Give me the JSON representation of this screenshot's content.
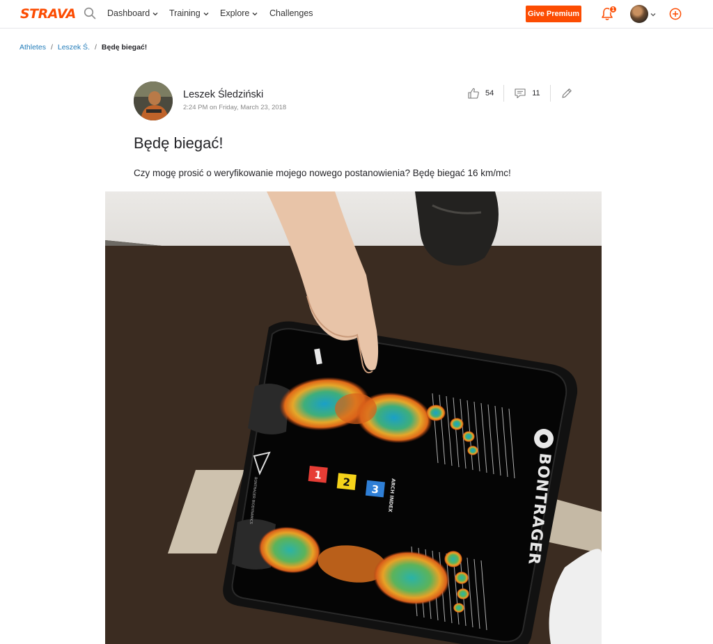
{
  "brand": {
    "logo": "STRAVA",
    "accent": "#fc4c02"
  },
  "nav": {
    "items": [
      {
        "label": "Dashboard",
        "has_dropdown": true
      },
      {
        "label": "Training",
        "has_dropdown": true
      },
      {
        "label": "Explore",
        "has_dropdown": true
      },
      {
        "label": "Challenges",
        "has_dropdown": false
      }
    ],
    "premium_label": "Give Premium",
    "notification_count": "1"
  },
  "breadcrumb": {
    "items": [
      "Athletes",
      "Leszek Ś."
    ],
    "current": "Będę biegać!"
  },
  "post": {
    "author": "Leszek Śledziński",
    "timestamp": "2:24 PM on Friday, March 23, 2018",
    "kudos_count": "54",
    "comment_count": "11",
    "title": "Będę biegać!",
    "body": "Czy mogę prosić o weryfikowanie mojego nowego postanowienia? Będę biegać 16 km/mc!",
    "photo": {
      "pad_brand": "BONTRAGER",
      "pad_subbrand": "BONTRAGER BIODYNAMICS",
      "arch_label": "ARCH INDEX",
      "arch_index_options": [
        "1",
        "2",
        "3"
      ]
    }
  }
}
